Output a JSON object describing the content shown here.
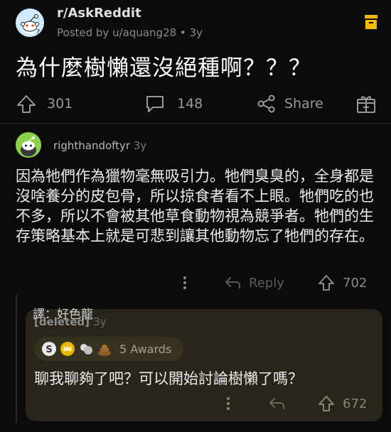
{
  "post": {
    "subreddit": "r/AskReddit",
    "posted_by": "Posted by u/aquang28 • 3y",
    "title": "為什麼樹懶還沒絕種啊？？？",
    "upvotes": "301",
    "comments": "148",
    "share_label": "Share"
  },
  "comment": {
    "user": "righthandoftyr",
    "time": "3y",
    "body": "因為牠們作為獵物毫無吸引力。牠們臭臭的，全身都是沒啥養分的皮包骨，所以掠食者看不上眼。牠們吃的也不多，所以不會被其他草食動物視為競爭者。牠們的生存策略基本上就是可悲到讓其他動物忘了牠們的存在。",
    "reply_label": "Reply",
    "votes": "702"
  },
  "reply": {
    "translator": "譯：好色龍",
    "user": "[deleted]",
    "time": "3y",
    "awards_label": "5 Awards",
    "body": "聊我聊夠了吧？可以開始討論樹懶了嗎？",
    "votes": "672"
  },
  "colors": {
    "background": "#0b0b0b",
    "reply_box": "#28251a",
    "save_icon": "#f5b800"
  },
  "icons": [
    "snoo-avatar",
    "save-icon",
    "upvote-icon",
    "comment-icon",
    "share-icon",
    "award-gift-icon",
    "more-icon",
    "reply-icon"
  ]
}
